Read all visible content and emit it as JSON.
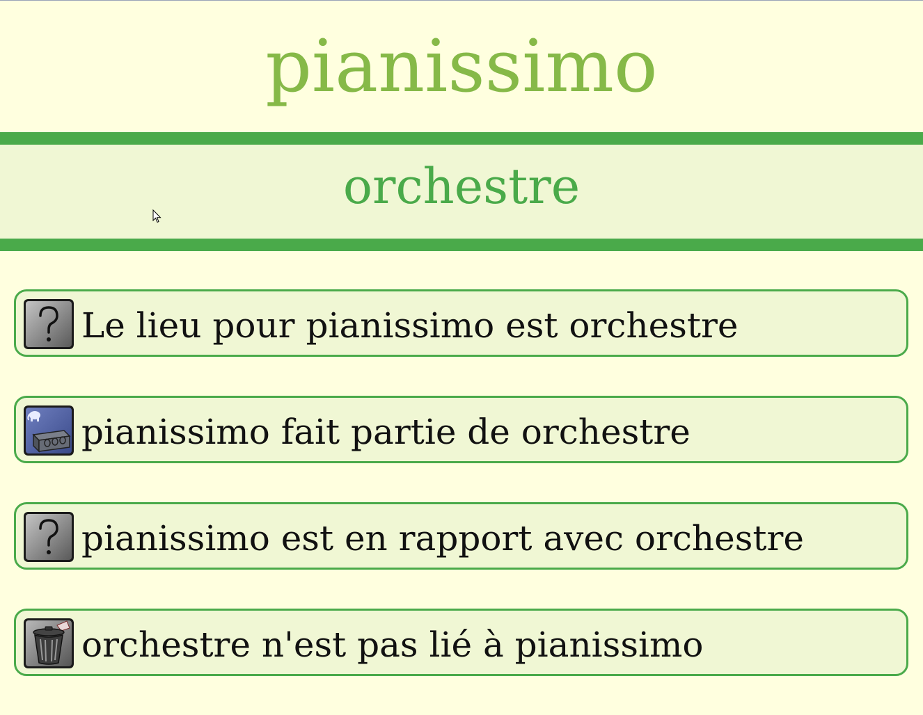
{
  "header": {
    "title": "pianissimo",
    "title_color": "#86b948"
  },
  "band": {
    "subtitle": "orchestre",
    "accent_color": "#4aaa4a",
    "background_color": "#f0f7d4"
  },
  "items": [
    {
      "icon": "question-mark-icon",
      "label": "Le lieu pour pianissimo est orchestre"
    },
    {
      "icon": "lego-brick-elephant-icon",
      "label": "pianissimo fait partie de orchestre"
    },
    {
      "icon": "question-mark-icon",
      "label": "pianissimo est en rapport avec orchestre"
    },
    {
      "icon": "trash-can-icon",
      "label": "orchestre n'est pas lié à pianissimo"
    }
  ],
  "page_background": "#ffffdf"
}
